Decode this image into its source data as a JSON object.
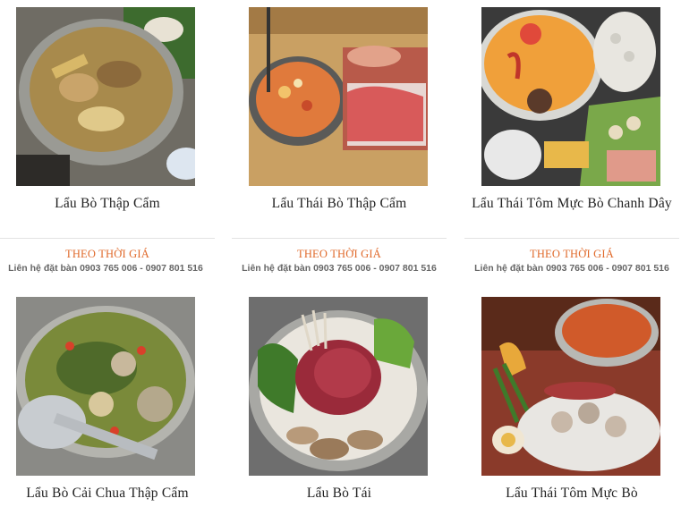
{
  "products": [
    {
      "name": "Lẩu Bò Thập Cẩm",
      "image_icon": "hotpot-beef-mixed-photo"
    },
    {
      "name": "Lẩu Thái Bò Thập Cẩm",
      "image_icon": "thai-hotpot-beef-photo"
    },
    {
      "name": "Lẩu Thái Tôm Mực Bò Chanh Dây",
      "image_icon": "thai-hotpot-seafood-passionfruit-photo"
    },
    {
      "name": "Lẩu Bò Cải Chua Thập Cẩm",
      "image_icon": "hotpot-sour-cabbage-photo"
    },
    {
      "name": "Lẩu Bò Tái",
      "image_icon": "hotpot-rare-beef-photo"
    },
    {
      "name": "Lẩu Thái Tôm Mực Bò",
      "image_icon": "thai-hotpot-shrimp-squid-photo"
    }
  ],
  "price_label": "THEO THỜI GIÁ",
  "contact_text": "Liên hệ đặt bàn 0903 765 006 - 0907 801 516",
  "colors": {
    "accent": "#e0692a",
    "contact": "#666666",
    "title": "#222222",
    "divider": "#e2e2e2"
  }
}
